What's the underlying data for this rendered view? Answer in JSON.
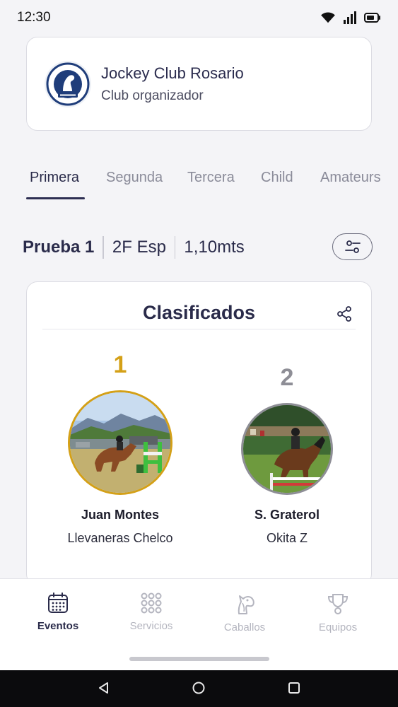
{
  "status_bar": {
    "time": "12:30"
  },
  "club": {
    "name": "Jockey Club Rosario",
    "subtitle": "Club organizador"
  },
  "tabs": [
    "Primera",
    "Segunda",
    "Tercera",
    "Child",
    "Amateurs"
  ],
  "active_tab": "Primera",
  "test": {
    "title": "Prueba 1",
    "type": "2F Esp",
    "height": "1,10mts"
  },
  "results": {
    "title": "Clasificados",
    "places": [
      {
        "rank": "1",
        "rider": "Juan Montes",
        "horse": "Llevaneras Chelco",
        "rank_color": "#d4a017"
      },
      {
        "rank": "2",
        "rider": "S. Graterol",
        "horse": "Okita Z",
        "rank_color": "#8e8e96"
      }
    ]
  },
  "bottom_nav": [
    {
      "label": "Eventos",
      "icon": "calendar-icon",
      "active": true
    },
    {
      "label": "Servicios",
      "icon": "grid-icon",
      "active": false
    },
    {
      "label": "Caballos",
      "icon": "horse-head-icon",
      "active": false
    },
    {
      "label": "Equipos",
      "icon": "trophy-icon",
      "active": false
    }
  ],
  "colors": {
    "primary": "#2a2b4a",
    "gold": "#d4a017",
    "silver": "#8e8e96",
    "inactive": "#b4b5bf"
  }
}
